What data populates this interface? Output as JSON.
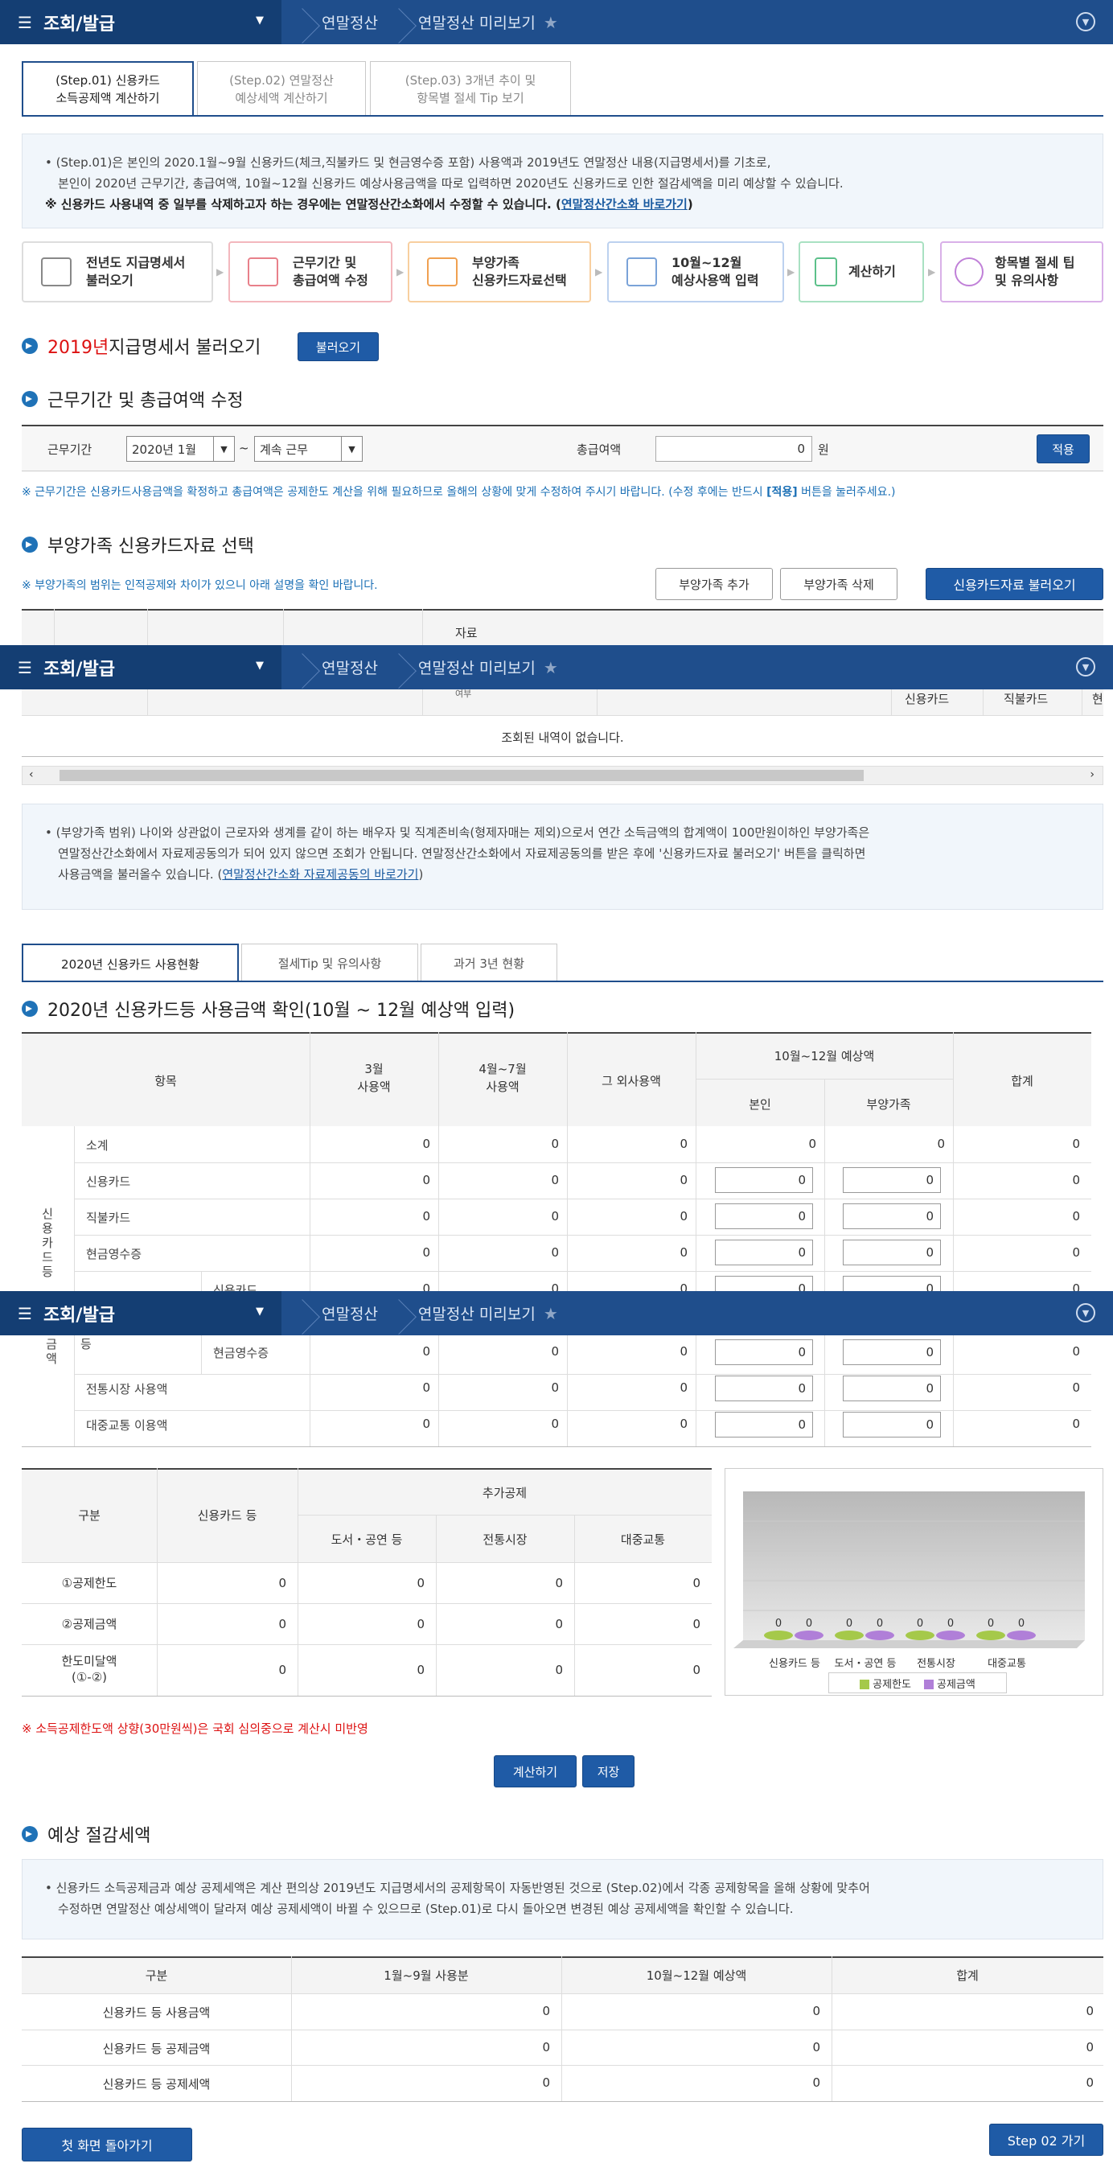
{
  "topbar": {
    "menu": "조회/발급",
    "crumb1": "연말정산",
    "crumb2": "연말정산 미리보기"
  },
  "steps": [
    {
      "l1": "(Step.01) 신용카드",
      "l2": "소득공제액 계산하기"
    },
    {
      "l1": "(Step.02) 연말정산",
      "l2": "예상세액 계산하기"
    },
    {
      "l1": "(Step.03) 3개년 추이 및",
      "l2": "항목별 절세 Tip 보기"
    }
  ],
  "info1": {
    "line1": "• (Step.01)은 본인의 2020.1월~9월 신용카드(체크,직불카드 및 현금영수증 포함) 사용액과 2019년도 연말정산 내용(지급명세서)를 기초로,",
    "line2": "본인이 2020년 근무기간, 총급여액, 10월~12월 신용카드 예상사용금액을 따로 입력하면 2020년도 신용카드로 인한 절감세액을 미리 예상할 수 있습니다.",
    "line3": "※ 신용카드 사용내역 중 일부를 삭제하고자 하는 경우에는 연말정산간소화에서 수정할 수 있습니다. (",
    "link": "연말정산간소화 바로가기",
    "close": ")"
  },
  "process": [
    {
      "l1": "전년도 지급명세서",
      "l2": "불러오기",
      "color": "#888888"
    },
    {
      "l1": "근무기간 및",
      "l2": "총급여액 수정",
      "color": "#e8808a"
    },
    {
      "l1": "부양가족",
      "l2": "신용카드자료선택",
      "color": "#f0a050"
    },
    {
      "l1": "10월~12월",
      "l2": "예상사용액 입력",
      "color": "#7aa3d8"
    },
    {
      "l1": "계산하기",
      "l2": "",
      "color": "#5cc08a"
    },
    {
      "l1": "항목별 절세 팁",
      "l2": "및 유의사항",
      "color": "#c080d8"
    }
  ],
  "sec1": {
    "year": "2019년",
    "title": " 지급명세서 불러오기",
    "btn": "불러오기"
  },
  "sec2": {
    "title": "근무기간 및 총급여액 수정",
    "work_label": "근무기간",
    "start": "2020년 1월",
    "tilde": "~",
    "end": "계속 근무",
    "pay_label": "총급여액",
    "pay": "0",
    "unit": "원",
    "apply": "적용",
    "note": "※ 근무기간은 신용카드사용금액을 확정하고 총급여액은 공제한도 계산을 위해 필요하므로 올해의 상황에 맞게 수정하여 주시기 바랍니다. (수정 후에는 반드시 ",
    "note_b": "[적용]",
    "note_e": " 버튼을 눌러주세요.)"
  },
  "sec3": {
    "title": "부양가족 신용카드자료 선택",
    "note": "※ 부양가족의 범위는 인적공제와 차이가 있으니 아래 설명을 확인 바랍니다.",
    "add": "부양가족 추가",
    "del": "부양가족 삭제",
    "load": "신용카드자료 불러오기",
    "h_data": "자료",
    "h_cut": "여부",
    "h_credit": "신용카드",
    "h_debit": "직불카드",
    "h_more": "현",
    "empty": "조회된 내역이 없습니다."
  },
  "info2": {
    "line1": "• (부양가족 범위) 나이와 상관없이 근로자와 생계를 같이 하는 배우자 및 직계존비속(형제자매는 제외)으로서 연간 소득금액의 합계액이 100만원이하인 부양가족은",
    "line2": "연말정산간소화에서 자료제공동의가 되어 있지 않으면 조회가 안됩니다. 연말정산간소화에서 자료제공동의를 받은 후에 '신용카드자료 불러오기' 버튼을 클릭하면",
    "line3": "사용금액을 불러올수 있습니다. (",
    "link": "연말정산간소화 자료제공동의 바로가기",
    "close": ")"
  },
  "subtabs": [
    "2020년 신용카드 사용현황",
    "절세Tip 및 유의사항",
    "과거 3년 현황"
  ],
  "sec4": {
    "title": "2020년 신용카드등 사용금액 확인(10월 ~ 12월 예상액 입력)"
  },
  "usage": {
    "h_item": "항목",
    "h_mar1": "3월",
    "h_mar2": "사용액",
    "h_apr1": "4월~7월",
    "h_apr2": "사용액",
    "h_other": "그 외사용액",
    "h_oct": "10월~12월 예상액",
    "h_self": "본인",
    "h_fam": "부양가족",
    "h_sum": "합계",
    "side": "신용카드등사용금액",
    "rows": [
      {
        "label": "소계",
        "a": "0",
        "b": "0",
        "c": "0",
        "d": "0",
        "e": "0",
        "f": "0"
      },
      {
        "label": "신용카드",
        "a": "0",
        "b": "0",
        "c": "0",
        "d": "0",
        "e": "0",
        "f": "0"
      },
      {
        "label": "직불카드",
        "a": "0",
        "b": "0",
        "c": "0",
        "d": "0",
        "e": "0",
        "f": "0"
      },
      {
        "label": "현금영수증",
        "a": "0",
        "b": "0",
        "c": "0",
        "d": "0",
        "e": "0",
        "f": "0"
      },
      {
        "label": "신용카드",
        "a": "0",
        "b": "0",
        "c": "0",
        "d": "0",
        "e": "0",
        "f": "0"
      }
    ],
    "sub_label": "등",
    "rows2": [
      {
        "label": "현금영수증",
        "a": "0",
        "b": "0",
        "c": "0",
        "d": "0",
        "e": "0",
        "f": "0"
      },
      {
        "label": "전통시장 사용액",
        "a": "0",
        "b": "0",
        "c": "0",
        "d": "0",
        "e": "0",
        "f": "0"
      },
      {
        "label": "대중교통 이용액",
        "a": "0",
        "b": "0",
        "c": "0",
        "d": "0",
        "e": "0",
        "f": "0"
      }
    ]
  },
  "deduct": {
    "h_kind": "구분",
    "h_card": "신용카드 등",
    "h_extra": "추가공제",
    "h_book": "도서・공연 등",
    "h_market": "전통시장",
    "h_bus": "대중교통",
    "rows": [
      {
        "label": "①공제한도",
        "v": [
          "0",
          "0",
          "0",
          "0"
        ]
      },
      {
        "label": "②공제금액",
        "v": [
          "0",
          "0",
          "0",
          "0"
        ]
      },
      {
        "label": "한도미달액",
        "label2": "(①-②)",
        "v": [
          "0",
          "0",
          "0",
          "0"
        ]
      }
    ]
  },
  "chart_data": {
    "type": "bar",
    "categories": [
      "신용카드 등",
      "도서・공연 등",
      "전통시장",
      "대중교통"
    ],
    "series": [
      {
        "name": "공제한도",
        "values": [
          0,
          0,
          0,
          0
        ]
      },
      {
        "name": "공제금액",
        "values": [
          0,
          0,
          0,
          0
        ]
      }
    ],
    "colors": [
      "#a5c94a",
      "#b07fd8"
    ]
  },
  "rednote": "※ 소득공제한도액 상향(30만원씩)은 국회 심의중으로 계산시 미반영",
  "calc": "계산하기",
  "save": "저장",
  "sec5": {
    "title": "예상 절감세액"
  },
  "info3": {
    "line1": "• 신용카드 소득공제금과 예상 공제세액은 계산 편의상 2019년도 지급명세서의 공제항목이 자동반영된 것으로 (Step.02)에서 각종 공제항목을 올해 상황에 맞추어",
    "line2": "수정하면 연말정산 예상세액이 달라져 예상 공제세액이 바뀔 수 있으므로 (Step.01)로 다시 돌아오면 변경된 예상 공제세액을 확인할 수 있습니다."
  },
  "saving": {
    "h_kind": "구분",
    "h_jan": "1월~9월 사용분",
    "h_oct": "10월~12월 예상액",
    "h_sum": "합계",
    "rows": [
      {
        "label": "신용카드 등 사용금액",
        "v": [
          "0",
          "0",
          "0"
        ]
      },
      {
        "label": "신용카드 등 공제금액",
        "v": [
          "0",
          "0",
          "0"
        ]
      },
      {
        "label": "신용카드 등 공제세액",
        "v": [
          "0",
          "0",
          "0"
        ]
      }
    ]
  },
  "btn_home": "첫 화면 돌아가기",
  "btn_next": "Step 02 가기"
}
